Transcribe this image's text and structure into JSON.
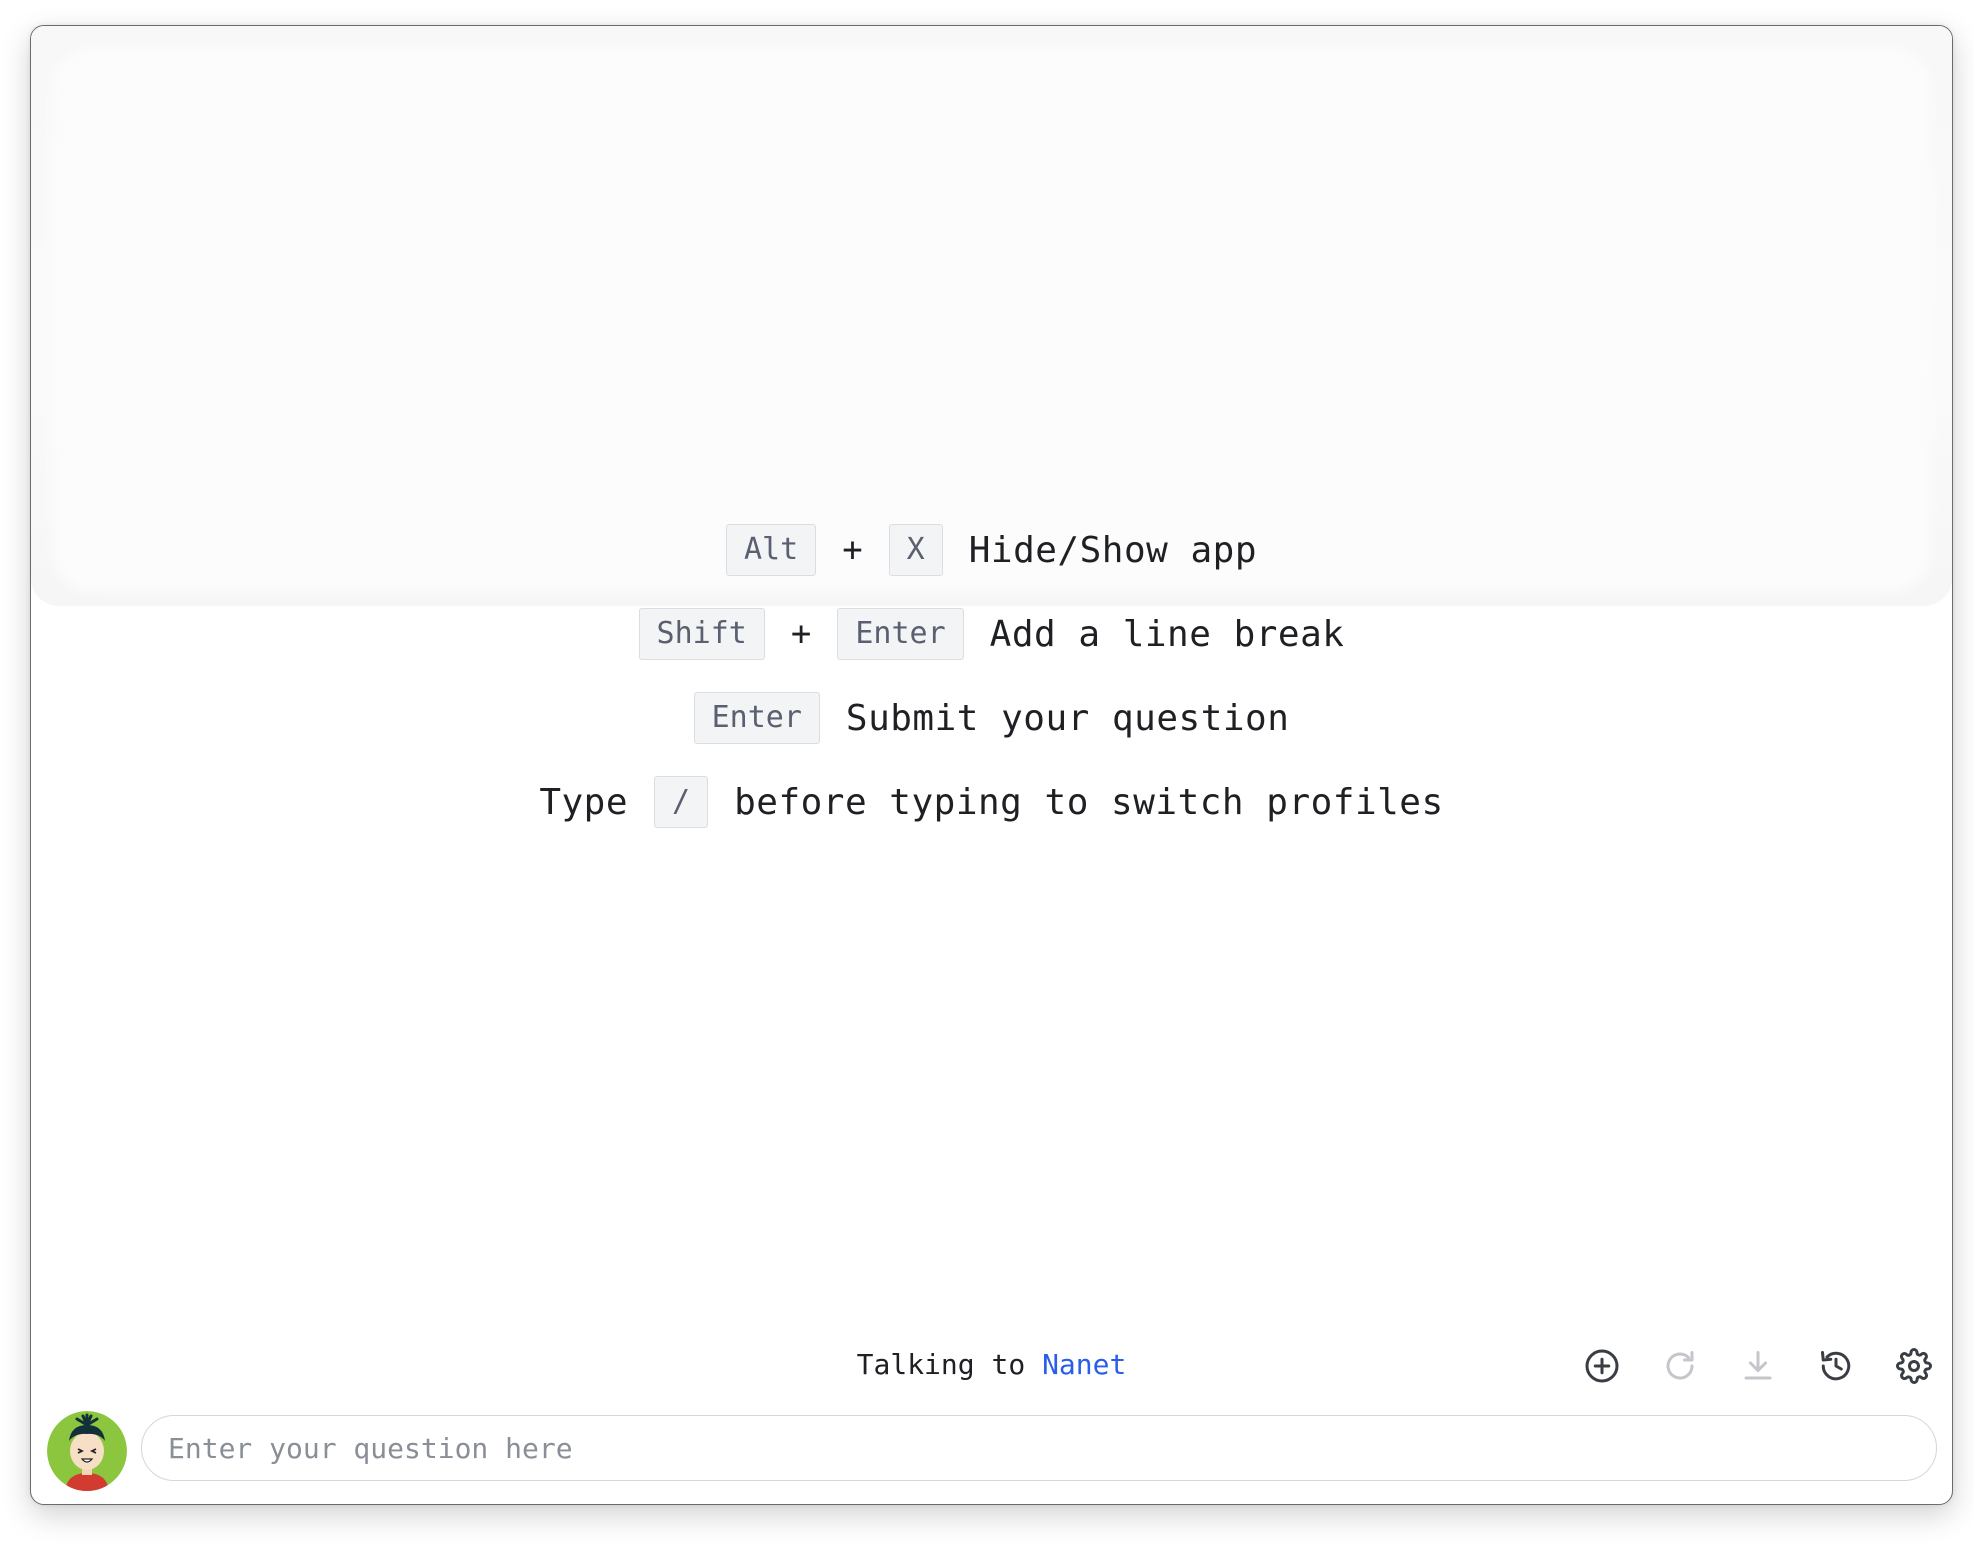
{
  "shortcuts": [
    {
      "keys": [
        "Alt",
        "X"
      ],
      "plus": "+",
      "description": "Hide/Show app"
    },
    {
      "keys": [
        "Shift",
        "Enter"
      ],
      "plus": "+",
      "description": "Add a line break"
    },
    {
      "keys": [
        "Enter"
      ],
      "description": "Submit your question"
    },
    {
      "prefix": "Type",
      "keys": [
        "/"
      ],
      "description": "before typing to switch profiles"
    }
  ],
  "status": {
    "prefix": "Talking to",
    "profile_name": "Nanet"
  },
  "toolbar": {
    "buttons": [
      {
        "name": "new-chat",
        "icon": "plus-circle-icon",
        "enabled": true
      },
      {
        "name": "regenerate",
        "icon": "refresh-icon",
        "enabled": false
      },
      {
        "name": "download",
        "icon": "download-icon",
        "enabled": false
      },
      {
        "name": "history",
        "icon": "history-icon",
        "enabled": true
      },
      {
        "name": "settings",
        "icon": "gear-icon",
        "enabled": true
      }
    ]
  },
  "input": {
    "placeholder": "Enter your question here",
    "value": ""
  },
  "colors": {
    "accent": "#2a5ee8",
    "text": "#1f2023",
    "kbd_bg": "#f3f4f6",
    "icon_enabled": "#3a3d44",
    "icon_disabled": "#c4c6cb",
    "avatar_bg": "#8cc63f"
  }
}
